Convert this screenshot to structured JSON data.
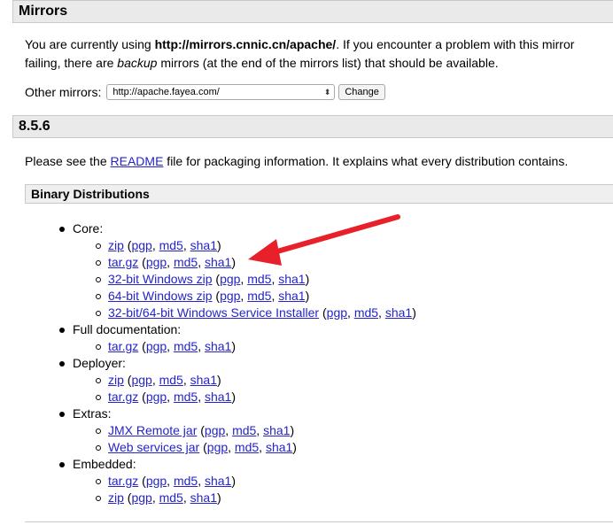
{
  "mirrors": {
    "heading": "Mirrors",
    "intro_prefix": "You are currently using ",
    "current_mirror": "http://mirrors.cnnic.cn/apache/",
    "intro_suffix": ". If you encounter a problem with this mirror",
    "line2_prefix": "failing, there are ",
    "line2_em": "backup",
    "line2_suffix": " mirrors (at the end of the mirrors list) that should be available.",
    "other_label": "Other mirrors:",
    "select_value": "http://apache.fayea.com/",
    "change_label": "Change"
  },
  "version": {
    "heading": "8.5.6",
    "see_prefix": "Please see the ",
    "readme_link": "README",
    "see_suffix": " file for packaging information. It explains what every distribution contains."
  },
  "binary": {
    "heading": "Binary Distributions",
    "groups": [
      {
        "label": "Core:",
        "items": [
          {
            "name": "zip",
            "pgp": "pgp",
            "md5": "md5",
            "sha1": "sha1"
          },
          {
            "name": "tar.gz",
            "pgp": "pgp",
            "md5": "md5",
            "sha1": "sha1"
          },
          {
            "name": "32-bit Windows zip",
            "pgp": "pgp",
            "md5": "md5",
            "sha1": "sha1"
          },
          {
            "name": "64-bit Windows zip",
            "pgp": "pgp",
            "md5": "md5",
            "sha1": "sha1"
          },
          {
            "name": "32-bit/64-bit Windows Service Installer",
            "pgp": "pgp",
            "md5": "md5",
            "sha1": "sha1"
          }
        ]
      },
      {
        "label": "Full documentation:",
        "items": [
          {
            "name": "tar.gz",
            "pgp": "pgp",
            "md5": "md5",
            "sha1": "sha1"
          }
        ]
      },
      {
        "label": "Deployer:",
        "items": [
          {
            "name": "zip",
            "pgp": "pgp",
            "md5": "md5",
            "sha1": "sha1"
          },
          {
            "name": "tar.gz",
            "pgp": "pgp",
            "md5": "md5",
            "sha1": "sha1"
          }
        ]
      },
      {
        "label": "Extras:",
        "items": [
          {
            "name": "JMX Remote jar",
            "pgp": "pgp",
            "md5": "md5",
            "sha1": "sha1"
          },
          {
            "name": "Web services jar",
            "pgp": "pgp",
            "md5": "md5",
            "sha1": "sha1"
          }
        ]
      },
      {
        "label": "Embedded:",
        "items": [
          {
            "name": "tar.gz",
            "pgp": "pgp",
            "md5": "md5",
            "sha1": "sha1"
          },
          {
            "name": "zip",
            "pgp": "pgp",
            "md5": "md5",
            "sha1": "sha1"
          }
        ]
      }
    ]
  },
  "annotation": {
    "arrow_color": "#e8202a",
    "target_item": "tar.gz"
  },
  "icons": {
    "select_chevron": "chevron-updown-icon",
    "annotation": "red-arrow-icon"
  }
}
